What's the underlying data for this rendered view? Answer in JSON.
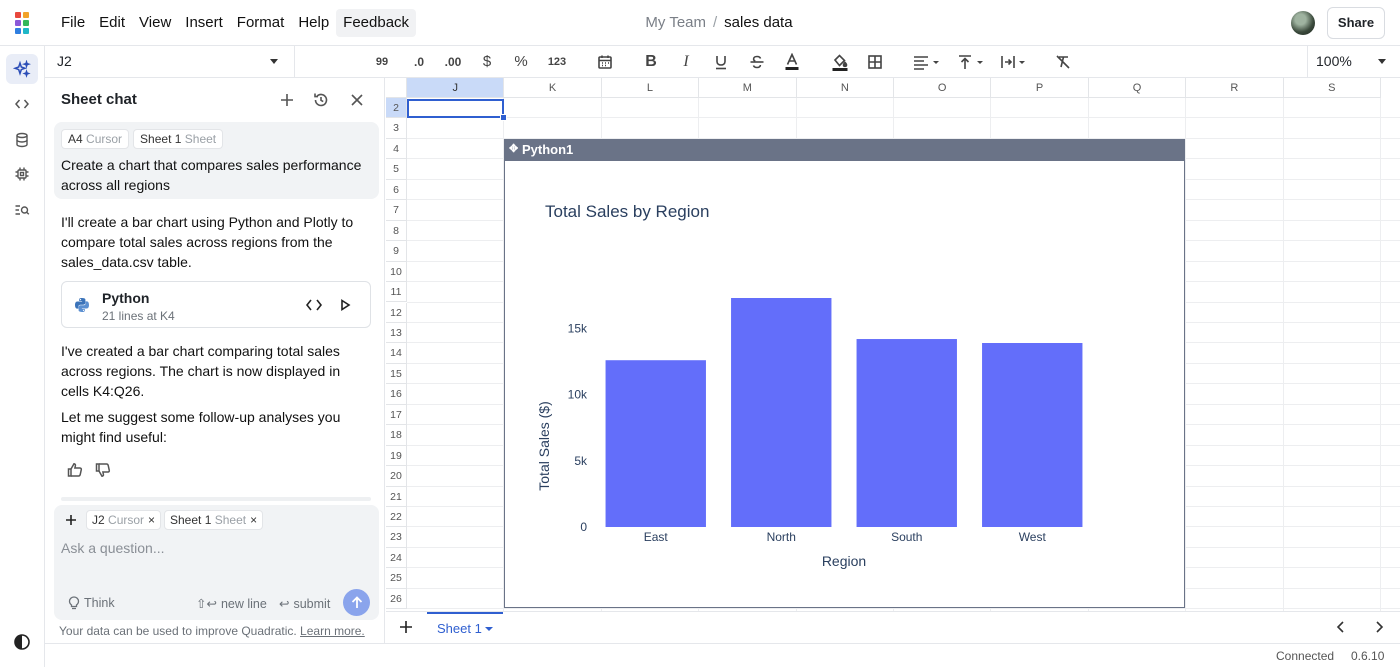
{
  "menu": {
    "items": [
      "File",
      "Edit",
      "View",
      "Insert",
      "Format",
      "Help",
      "Feedback"
    ],
    "active_index": 6
  },
  "breadcrumb": {
    "team": "My Team",
    "separator": "/",
    "file": "sales data"
  },
  "share_label": "Share",
  "rail": {
    "icons": [
      "ai-sparkle-icon",
      "code-icon",
      "database-icon",
      "chip-icon",
      "search-list-icon",
      "theme-toggle-icon"
    ]
  },
  "toolbar": {
    "name_box": "J2",
    "format_labels": {
      "quote": "99",
      "decrease_decimals": ".0",
      "increase_decimals": ".00",
      "currency": "$",
      "percent": "%",
      "number": "123"
    },
    "zoom": "100%"
  },
  "chat": {
    "title": "Sheet chat",
    "user_message": {
      "context": [
        {
          "label": "A4",
          "kind": "Cursor"
        },
        {
          "label": "Sheet 1",
          "kind": "Sheet"
        }
      ],
      "text": "Create a chart that compares sales performance across all regions"
    },
    "assistant_intro": "I'll create a bar chart using Python and Plotly to compare total sales across regions from the sales_data.csv table.",
    "code_card": {
      "title": "Python",
      "subtitle": "21 lines at K4"
    },
    "assistant_result": "I've created a bar chart comparing total sales across regions. The chart is now displayed in cells K4:Q26.",
    "assistant_followup": "Let me suggest some follow-up analyses you might find useful:",
    "composer": {
      "context": [
        {
          "label": "J2",
          "kind": "Cursor"
        },
        {
          "label": "Sheet 1",
          "kind": "Sheet"
        }
      ],
      "placeholder": "Ask a question...",
      "think_label": "Think",
      "newline_hint": "new line",
      "submit_hint": "submit"
    },
    "disclaimer": "Your data can be used to improve Quadratic.",
    "disclaimer_link": "Learn more."
  },
  "grid": {
    "columns": [
      "J",
      "K",
      "L",
      "M",
      "N",
      "O",
      "P",
      "Q",
      "R",
      "S"
    ],
    "rows": [
      "2",
      "3",
      "4",
      "5",
      "6",
      "7",
      "8",
      "9",
      "10",
      "11",
      "12",
      "13",
      "14",
      "15",
      "16",
      "17",
      "18",
      "19",
      "20",
      "21",
      "22",
      "23",
      "24",
      "25",
      "26"
    ],
    "selected_cell": "J2",
    "code_cell_name": "Python1"
  },
  "chart_data": {
    "type": "bar",
    "title": "Total Sales by Region",
    "categories": [
      "East",
      "North",
      "South",
      "West"
    ],
    "values": [
      12600,
      17300,
      14200,
      13900
    ],
    "xlabel": "Region",
    "ylabel": "Total Sales ($)",
    "ylim": [
      0,
      17300
    ],
    "yticks": [
      0,
      5000,
      10000,
      15000
    ],
    "ytick_labels": [
      "0",
      "5k",
      "10k",
      "15k"
    ],
    "bar_color": "#636efa",
    "grid": false,
    "legend": "none"
  },
  "sheets": {
    "tabs": [
      "Sheet 1"
    ],
    "active": "Sheet 1"
  },
  "status": {
    "connection": "Connected",
    "version": "0.6.10"
  }
}
